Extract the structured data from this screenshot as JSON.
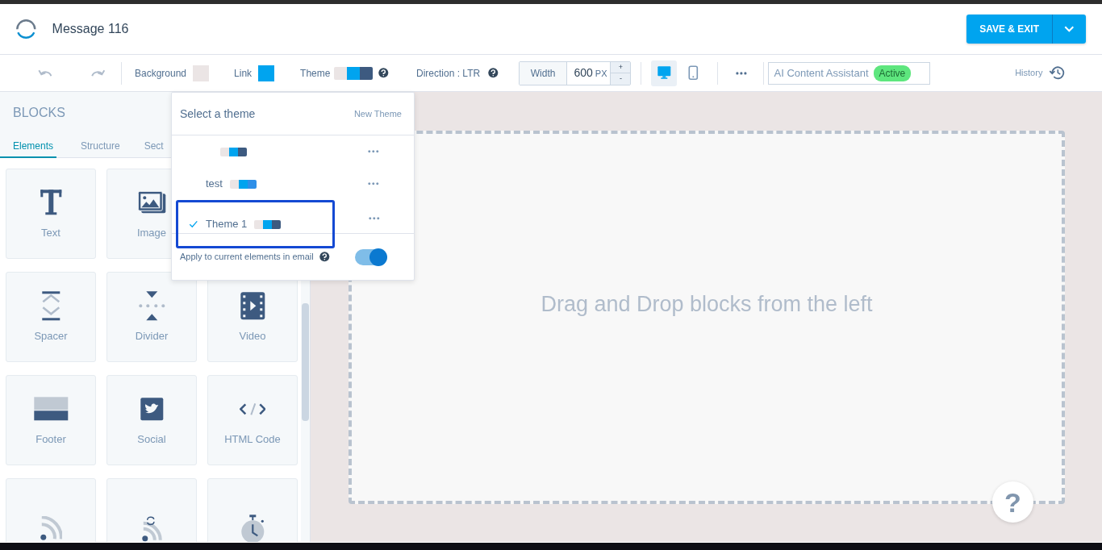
{
  "header": {
    "title": "Message 116",
    "save_button": "SAVE & EXIT"
  },
  "toolbar": {
    "background_label": "Background",
    "background_swatch": {
      "color": "#ebe5e5"
    },
    "link_label": "Link",
    "link_swatch": {
      "color": "#00a4ef"
    },
    "theme_label": "Theme",
    "theme_swatch": [
      {
        "color": "#ebe5e5"
      },
      {
        "color": "#00a4ef"
      },
      {
        "color": "#3d5a80"
      }
    ],
    "direction": "Direction : LTR",
    "width_label": "Width",
    "width_value": "600",
    "width_unit": "PX",
    "increment": "+",
    "decrement": "-",
    "devices": [
      {
        "kind": "desktop",
        "selected": true
      },
      {
        "kind": "mobile",
        "selected": false
      }
    ],
    "ai_assistant": "AI Content Assistant",
    "ai_status": "Active",
    "history": "History"
  },
  "sidebar": {
    "title": "BLOCKS",
    "tabs": [
      {
        "label": "Elements",
        "selected": true
      },
      {
        "label": "Structure",
        "selected": false
      },
      {
        "label": "Sect",
        "selected": false
      }
    ],
    "rows": [
      [
        {
          "kind": "text",
          "label": "Text"
        },
        {
          "kind": "image",
          "label": "Image"
        }
      ],
      [
        {
          "kind": "spacer",
          "label": "Spacer"
        },
        {
          "kind": "divider",
          "label": "Divider"
        },
        {
          "kind": "video",
          "label": "Video"
        }
      ],
      [
        {
          "kind": "footer",
          "label": "Footer"
        },
        {
          "kind": "social",
          "label": "Social"
        },
        {
          "kind": "html",
          "label": "HTML Code"
        }
      ],
      [
        {
          "kind": "rss"
        },
        {
          "kind": "live_rss"
        },
        {
          "kind": "countdown"
        }
      ]
    ]
  },
  "theme_menu": {
    "title": "Select a theme",
    "new_theme": "New Theme",
    "themes": [
      {
        "swatch": [
          {
            "color": "#ebe5e5"
          },
          {
            "color": "#00a4ef"
          },
          {
            "color": "#3d5a80"
          }
        ],
        "selected": false
      },
      {
        "name": "test",
        "swatch": [
          {
            "color": "#ebe5e5"
          },
          {
            "color": "#00a4ef"
          },
          {
            "color": "#2e8fe8"
          }
        ],
        "selected": false
      },
      {
        "name": "Theme 1",
        "swatch": [
          {
            "color": "#ebe5e5"
          },
          {
            "color": "#00a4ef"
          },
          {
            "color": "#3d5a80"
          }
        ],
        "selected": true,
        "highlighted": true
      }
    ],
    "apply_label": "Apply to current elements in email",
    "apply_on": true
  },
  "canvas": {
    "drop_hint": "Drag and Drop blocks from the left",
    "help": "?"
  }
}
